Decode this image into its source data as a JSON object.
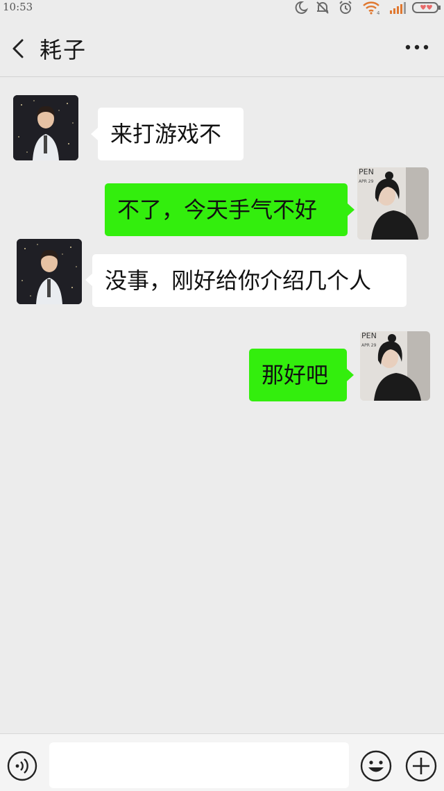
{
  "status_bar": {
    "time": "10:53",
    "icons": [
      "moon-icon",
      "bell-off-icon",
      "alarm-icon",
      "wifi-icon",
      "signal-icon",
      "battery-icon"
    ]
  },
  "header": {
    "title": "耗子",
    "back_icon": "chevron-left-icon",
    "more_icon": "more-dots-icon"
  },
  "messages": [
    {
      "side": "in",
      "text": "来打游戏不"
    },
    {
      "side": "out",
      "text": "不了，今天手气不好"
    },
    {
      "side": "in",
      "text": "没事，刚好给你介绍几个人"
    },
    {
      "side": "out",
      "text": "那好吧"
    }
  ],
  "input_bar": {
    "value": "",
    "voice_icon": "voice-icon",
    "emoji_icon": "emoji-icon",
    "plus_icon": "plus-icon"
  },
  "colors": {
    "background": "#ececec",
    "outgoing_bubble": "#33ee0d",
    "incoming_bubble": "#ffffff"
  }
}
